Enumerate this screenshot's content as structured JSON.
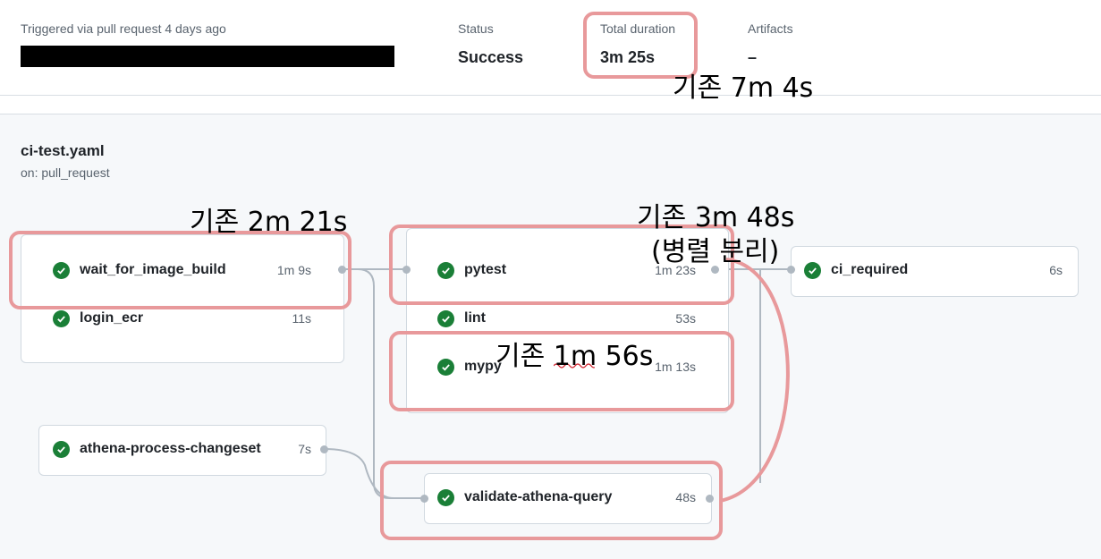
{
  "summary": {
    "trigger": "Triggered via pull request 4 days ago",
    "status_label": "Status",
    "status_value": "Success",
    "duration_label": "Total duration",
    "duration_value": "3m 25s",
    "artifacts_label": "Artifacts",
    "artifacts_value": "–"
  },
  "workflow": {
    "name": "ci-test.yaml",
    "trigger": "on: pull_request"
  },
  "jobs": {
    "wait_for_image_build": {
      "name": "wait_for_image_build",
      "duration": "1m 9s",
      "status": "success"
    },
    "login_ecr": {
      "name": "login_ecr",
      "duration": "11s",
      "status": "success"
    },
    "athena_process_changeset": {
      "name": "athena-process-changeset",
      "duration": "7s",
      "status": "success"
    },
    "pytest": {
      "name": "pytest",
      "duration": "1m 23s",
      "status": "success"
    },
    "lint": {
      "name": "lint",
      "duration": "53s",
      "status": "success"
    },
    "mypy": {
      "name": "mypy",
      "duration": "1m 13s",
      "status": "success"
    },
    "validate_athena_query": {
      "name": "validate-athena-query",
      "duration": "48s",
      "status": "success"
    },
    "ci_required": {
      "name": "ci_required",
      "duration": "6s",
      "status": "success"
    }
  },
  "annotations": {
    "total_before": "기존 7m 4s",
    "wait_before": "기존 2m 21s",
    "pytest_before": "기존 3m 48s",
    "pytest_note": "(병렬 분리)",
    "mypy_before": "기존 1m 56s"
  },
  "colors": {
    "success": "#1a7f37",
    "highlight": "#e8999b",
    "connector": "#afb8c1"
  },
  "icons": {
    "status": "check-circle-icon"
  }
}
